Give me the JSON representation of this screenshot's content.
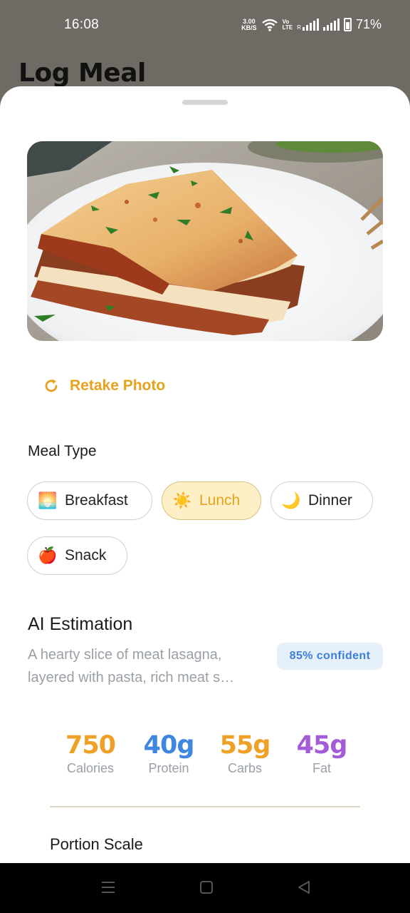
{
  "status_bar": {
    "time": "16:08",
    "net_speed_value": "3.00",
    "net_speed_unit": "KB/S",
    "volte_top": "Vo",
    "volte_bottom": "LTE",
    "volte_sub": "R",
    "battery": "71%"
  },
  "page": {
    "title": "Log Meal"
  },
  "photo": {
    "subject": "meat lasagna on white plate",
    "icon": "food-photo"
  },
  "retake": {
    "label": "Retake Photo",
    "icon": "refresh-icon",
    "color": "#e8a21d"
  },
  "meal_type": {
    "title": "Meal Type",
    "options": [
      {
        "label": "Breakfast",
        "emoji": "🌅",
        "selected": false
      },
      {
        "label": "Lunch",
        "emoji": "☀️",
        "selected": true
      },
      {
        "label": "Dinner",
        "emoji": "🌙",
        "selected": false
      },
      {
        "label": "Snack",
        "emoji": "🍎",
        "selected": false
      }
    ]
  },
  "ai_estimation": {
    "title": "AI Estimation",
    "description": "A hearty slice of meat lasagna, layered with pasta, rich meat s…",
    "confidence": "85% confident"
  },
  "nutrition": [
    {
      "value": "750",
      "label": "Calories",
      "color": "#eea126"
    },
    {
      "value": "40g",
      "label": "Protein",
      "color": "#3f86e0"
    },
    {
      "value": "55g",
      "label": "Carbs",
      "color": "#eea126"
    },
    {
      "value": "45g",
      "label": "Fat",
      "color": "#a35bd6"
    }
  ],
  "portion": {
    "title": "Portion Scale"
  },
  "nav": {
    "menu_icon": "menu-icon",
    "home_icon": "home-square-icon",
    "back_icon": "back-triangle-icon"
  }
}
